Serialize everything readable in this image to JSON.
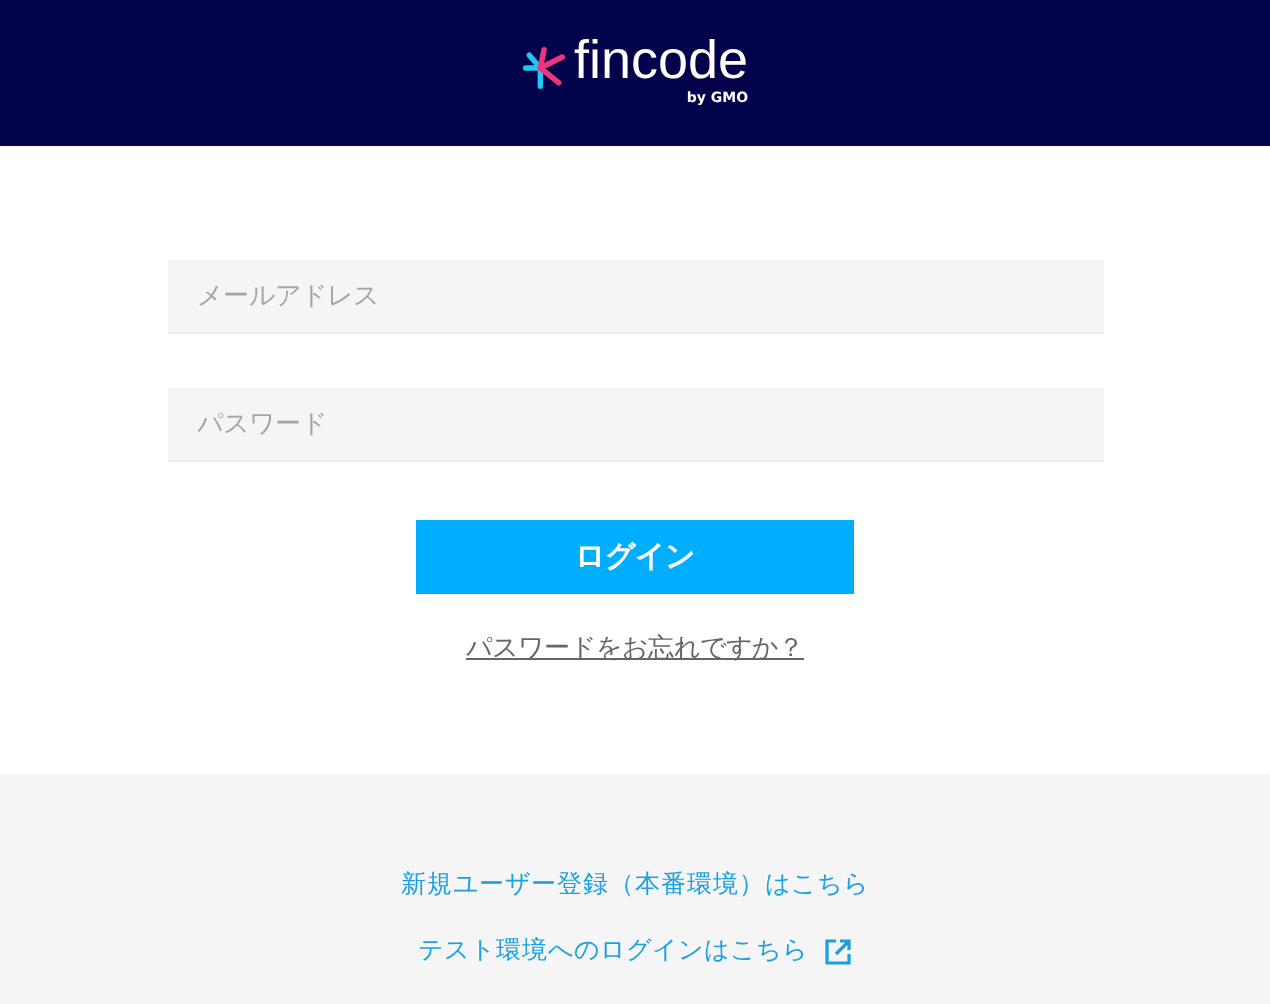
{
  "header": {
    "logo_text": "fincode",
    "logo_sub": "by GMO"
  },
  "fields": [
    {
      "placeholder": "メールアドレス"
    },
    {
      "placeholder": "パスワード"
    }
  ],
  "login_button": "ログイン",
  "forgot_link": "パスワードをお忘れですか？",
  "footer_links": [
    {
      "label": "新規ユーザー登録（本番環境）はこちら",
      "external": false
    },
    {
      "label": "テスト環境へのログインはこちら",
      "external": true
    }
  ]
}
